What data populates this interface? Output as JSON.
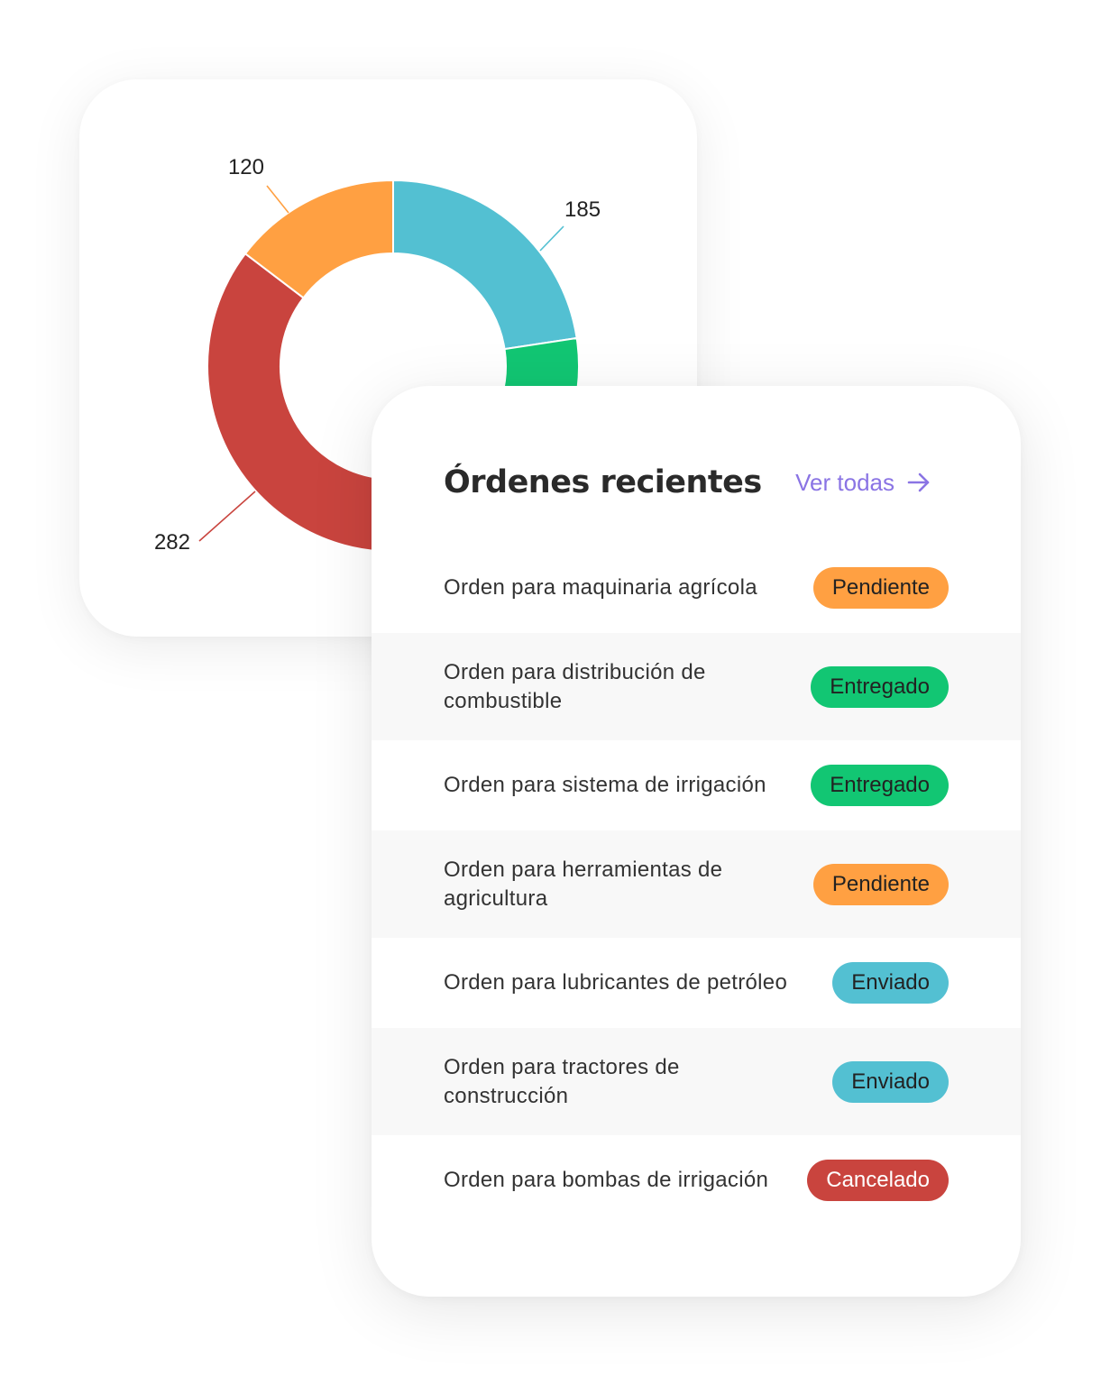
{
  "colors": {
    "pending": "#ffa042",
    "delivered": "#12c673",
    "sent": "#53c0d2",
    "cancelled": "#c9443e",
    "link": "#8a74e4"
  },
  "chart_data": {
    "type": "pie",
    "donut": true,
    "slices": [
      {
        "label": "185",
        "value": 185,
        "color": "#53c0d2"
      },
      {
        "label": "",
        "value": 232,
        "color": "#12c673"
      },
      {
        "label": "282",
        "value": 282,
        "color": "#c9443e"
      },
      {
        "label": "120",
        "value": 120,
        "color": "#ffa042"
      }
    ],
    "title": ""
  },
  "orders": {
    "title": "Órdenes recientes",
    "view_all_label": "Ver todas",
    "view_all_icon": "arrow-right-icon",
    "items": [
      {
        "name": "Orden para maquinaria agrícola",
        "status": "Pendiente",
        "status_key": "pending"
      },
      {
        "name": "Orden para distribución de combustible",
        "status": "Entregado",
        "status_key": "delivered"
      },
      {
        "name": "Orden para sistema de irrigación",
        "status": "Entregado",
        "status_key": "delivered"
      },
      {
        "name": "Orden para herramientas de agricultura",
        "status": "Pendiente",
        "status_key": "pending"
      },
      {
        "name": "Orden para lubricantes de petróleo",
        "status": "Enviado",
        "status_key": "sent"
      },
      {
        "name": "Orden para tractores de construcción",
        "status": "Enviado",
        "status_key": "sent"
      },
      {
        "name": "Orden para bombas de irrigación",
        "status": "Cancelado",
        "status_key": "cancelled"
      }
    ]
  }
}
